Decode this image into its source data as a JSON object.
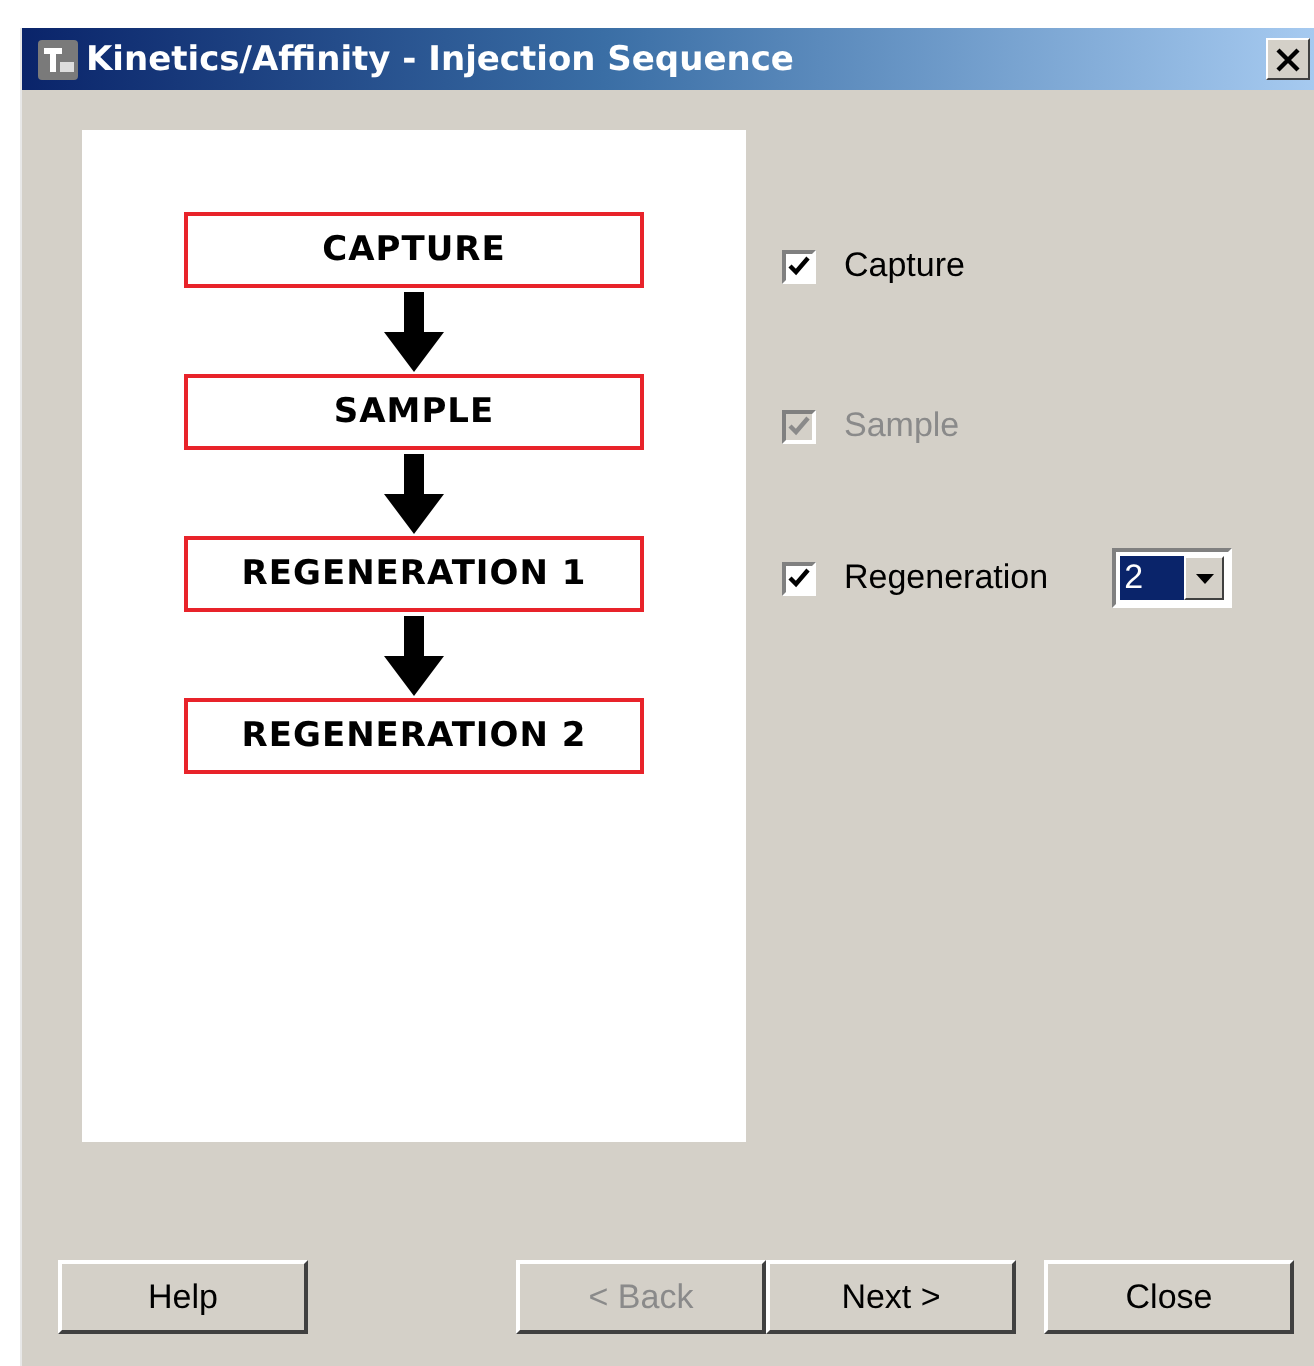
{
  "window": {
    "title": "Kinetics/Affinity - Injection Sequence"
  },
  "flow_steps": [
    {
      "label": "CAPTURE"
    },
    {
      "label": "SAMPLE"
    },
    {
      "label": "REGENERATION 1"
    },
    {
      "label": "REGENERATION 2"
    }
  ],
  "options": [
    {
      "label": "Capture",
      "checked": true,
      "disabled": false
    },
    {
      "label": "Sample",
      "checked": true,
      "disabled": true
    },
    {
      "label": "Regeneration",
      "checked": true,
      "disabled": false,
      "dropdown": {
        "value": "2"
      }
    }
  ],
  "buttons": [
    {
      "label": "Help",
      "disabled": false
    },
    {
      "label": "< Back",
      "disabled": true
    },
    {
      "label": "Next >",
      "disabled": false
    },
    {
      "label": "Close",
      "disabled": false
    }
  ]
}
